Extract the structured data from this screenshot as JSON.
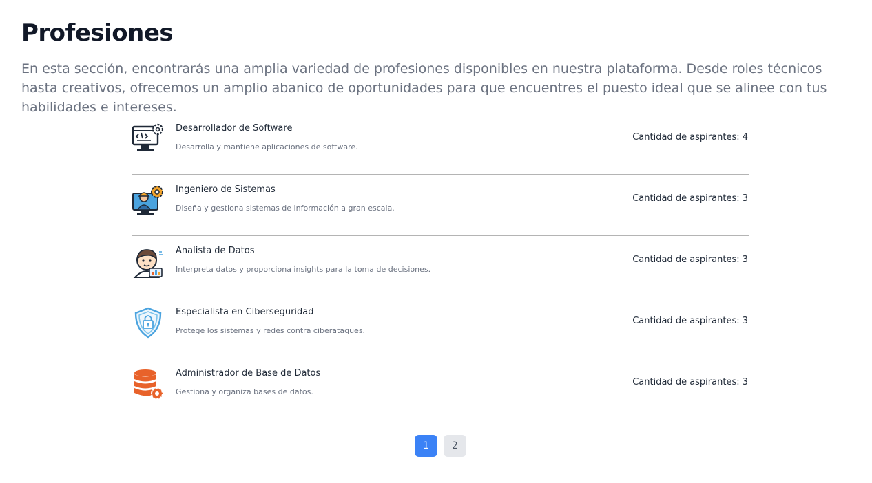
{
  "header": {
    "title": "Profesiones",
    "intro": "En esta sección, encontrarás una amplia variedad de profesiones disponibles en nuestra plataforma. Desde roles técnicos hasta creativos, ofrecemos un amplio abanico de oportunidades para que encuentres el puesto ideal que se alinee con tus habilidades e intereses."
  },
  "professions": [
    {
      "title": "Desarrollador de Software",
      "description": "Desarrolla y mantiene aplicaciones de software.",
      "count": "Cantidad de aspirantes: 4",
      "icon": "code-monitor-gear-icon"
    },
    {
      "title": "Ingeniero de Sistemas",
      "description": "Diseña y gestiona sistemas de información a gran escala.",
      "count": "Cantidad de aspirantes: 3",
      "icon": "engineer-monitor-gear-icon"
    },
    {
      "title": "Analista de Datos",
      "description": "Interpreta datos y proporciona insights para la toma de decisiones.",
      "count": "Cantidad de aspirantes: 3",
      "icon": "analyst-person-chart-icon"
    },
    {
      "title": "Especialista en Ciberseguridad",
      "description": "Protege los sistemas y redes contra ciberataques.",
      "count": "Cantidad de aspirantes: 3",
      "icon": "shield-lock-icon"
    },
    {
      "title": "Administrador de Base de Datos",
      "description": "Gestiona y organiza bases de datos.",
      "count": "Cantidad de aspirantes: 3",
      "icon": "database-gear-icon"
    }
  ],
  "pagination": {
    "pages": [
      "1",
      "2"
    ],
    "current": "1"
  },
  "colors": {
    "accent": "#3b82f6",
    "inactive_page": "#e5e7eb",
    "muted_text": "#6b7280",
    "database_icon": "#e8622a"
  }
}
